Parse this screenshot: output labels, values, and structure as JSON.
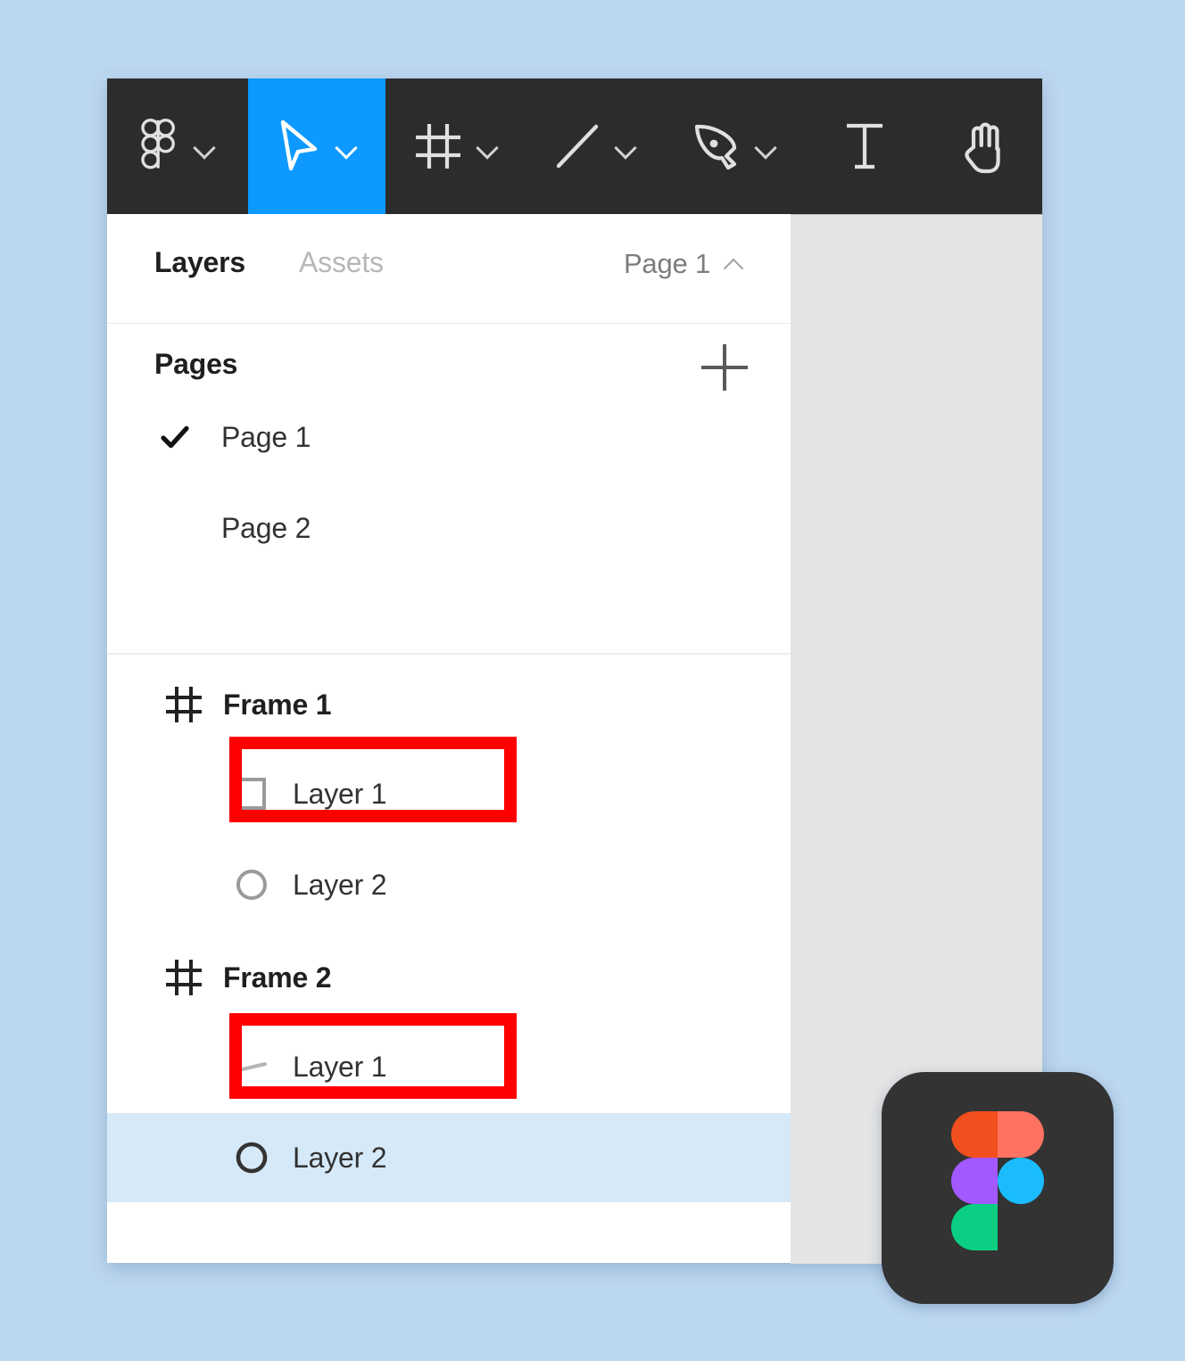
{
  "app": {
    "name": "Figma",
    "accent_blue": "#0d99ff",
    "toolbar_bg": "#2c2c2c",
    "selection_row_bg": "#d6e9f8",
    "annotation_color": "#ff0000",
    "canvas_bg": "#e4e4e4",
    "page_bg": "#bcd7f0"
  },
  "toolbar": {
    "tools": [
      {
        "name": "figma-menu",
        "icon": "figma-logo-icon",
        "has_dropdown": true,
        "active": false
      },
      {
        "name": "move-tool",
        "icon": "cursor-arrow-icon",
        "has_dropdown": true,
        "active": true
      },
      {
        "name": "frame-tool",
        "icon": "frame-hash-icon",
        "has_dropdown": true,
        "active": false
      },
      {
        "name": "shape-tool",
        "icon": "line-diagonal-icon",
        "has_dropdown": true,
        "active": false
      },
      {
        "name": "pen-tool",
        "icon": "pen-nib-icon",
        "has_dropdown": true,
        "active": false
      },
      {
        "name": "text-tool",
        "icon": "text-t-icon",
        "has_dropdown": false,
        "active": false
      },
      {
        "name": "hand-tool",
        "icon": "hand-icon",
        "has_dropdown": false,
        "active": false
      }
    ]
  },
  "panel": {
    "tabs": {
      "layers_label": "Layers",
      "assets_label": "Assets",
      "active_tab": "Layers"
    },
    "page_selector": {
      "label": "Page 1",
      "chevron": "chevron-up-icon"
    },
    "pages_section": {
      "title": "Pages",
      "add_button_icon": "plus-icon",
      "pages": [
        {
          "label": "Page 1",
          "checked": true
        },
        {
          "label": "Page 2",
          "checked": false
        }
      ]
    },
    "layers_tree": [
      {
        "label": "Frame 1",
        "icon": "frame-hash-icon",
        "type": "frame",
        "annotated": true,
        "selected": false
      },
      {
        "label": "Layer 1",
        "icon": "rectangle-icon",
        "type": "child",
        "annotated": false,
        "selected": false
      },
      {
        "label": "Layer 2",
        "icon": "ellipse-icon",
        "type": "child",
        "annotated": false,
        "selected": false
      },
      {
        "label": "Frame 2",
        "icon": "frame-hash-icon",
        "type": "frame",
        "annotated": true,
        "selected": false
      },
      {
        "label": "Layer 1",
        "icon": "line-icon",
        "type": "child",
        "annotated": false,
        "selected": false
      },
      {
        "label": "Layer 2",
        "icon": "ellipse-icon",
        "type": "child",
        "annotated": false,
        "selected": true
      }
    ]
  },
  "badge": {
    "name": "figma-logo-badge",
    "colors": {
      "orange": "#f24e1e",
      "salmon": "#ff7262",
      "purple": "#a259ff",
      "blue": "#1abcfe",
      "green": "#0acf83",
      "background": "#333333"
    }
  }
}
